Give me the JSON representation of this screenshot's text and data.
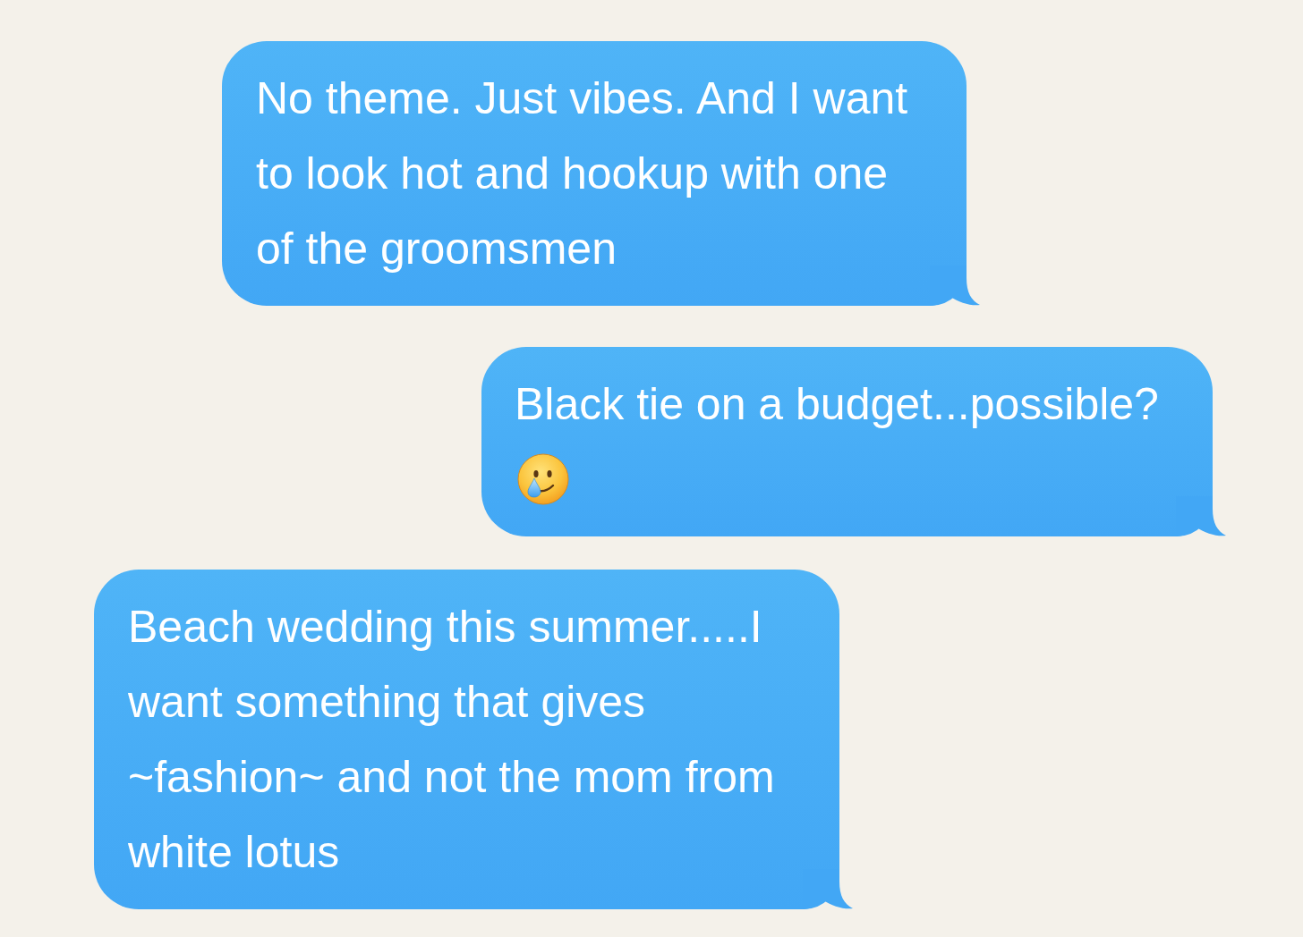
{
  "messages": [
    {
      "text": "No theme. Just vibes. And I want to look hot and hookup with one of the groomsmen",
      "emoji": false
    },
    {
      "text": "Black tie on a budget...possible?",
      "emoji": true
    },
    {
      "text": "Beach wedding this summer.....I want something that gives ~fashion~ and not the mom from white lotus",
      "emoji": false
    }
  ]
}
